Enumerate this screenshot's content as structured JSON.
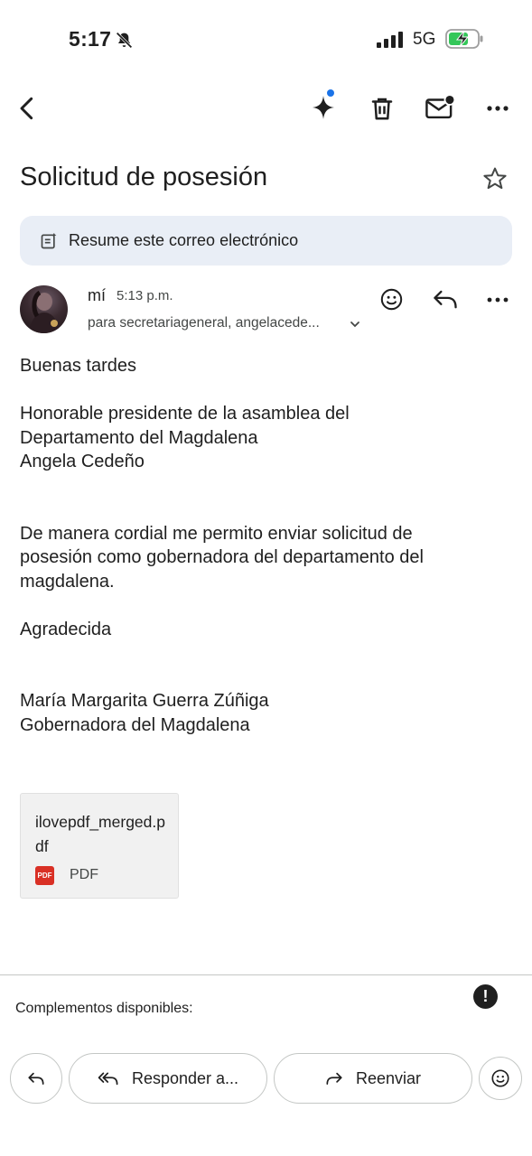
{
  "status_bar": {
    "time": "5:17",
    "network": "5G",
    "icons": [
      "bell-off-icon",
      "signal-icon",
      "battery-charging-icon"
    ]
  },
  "toolbar": {
    "icons": [
      "back-arrow-icon",
      "gemini-sparkle-icon",
      "trash-icon",
      "mark-unread-icon",
      "more-horizontal-icon"
    ]
  },
  "email": {
    "subject": "Solicitud de posesión",
    "summary_chip": "Resume este correo electrónico",
    "sender": "mí",
    "time": "5:13 p.m.",
    "recipients": "para secretariageneral, angelacede...",
    "body": [
      "Buenas tardes",
      "",
      "Honorable presidente de la asamblea del",
      "Departamento del Magdalena",
      "Angela Cedeño",
      "",
      "",
      "De manera cordial me permito enviar solicitud de",
      "posesión como gobernadora del departamento del",
      "magdalena.",
      "",
      "Agradecida",
      "",
      "",
      "María Margarita Guerra Zúñiga",
      "Gobernadora del Magdalena"
    ],
    "attachment": {
      "name": "ilovepdf_merged.pdf",
      "badge": "PDF",
      "type": "PDF"
    }
  },
  "bottom": {
    "addons_label": "Complementos disponibles:",
    "alert_glyph": "!",
    "reply_all_label": "Responder a...",
    "forward_label": "Reenviar"
  },
  "colors": {
    "accent_dot": "#1a73e8",
    "chip_bg": "#e9eef6",
    "pdf_red": "#d93025",
    "battery_green": "#34c759"
  }
}
